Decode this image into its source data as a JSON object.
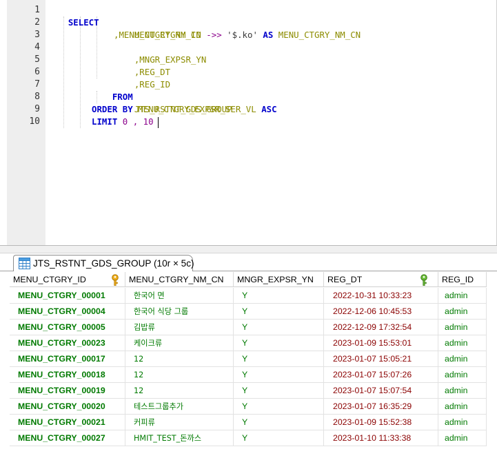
{
  "editor": {
    "line_numbers": [
      "1",
      "2",
      "3",
      "4",
      "5",
      "6",
      "7",
      "8",
      "9",
      "10"
    ],
    "sql": {
      "kw_select": "SELECT",
      "col_menu_ctgry_id": "MENU_CTGRY_ID",
      "line3_comma_col": ",MENU_CTGRY_NM_CN",
      "line3_op": "->>",
      "line3_str": "'$.ko'",
      "kw_as": "AS",
      "line3_alias": "MENU_CTGRY_NM_CN",
      "line4": ",MNGR_EXPSR_YN",
      "line5": ",REG_DT",
      "line6": ",REG_ID",
      "kw_from": "FROM",
      "table_name": "JTS_RSTNT_GDS_GROUP",
      "kw_order_by": "ORDER BY",
      "order_col": "MENU_CTGRY_EXPSR_SER_VL",
      "kw_asc": "ASC",
      "kw_limit": "LIMIT",
      "limit_offset": "0",
      "limit_comma": ",",
      "limit_count": "10"
    }
  },
  "result_tab": {
    "label": "JTS_RSTNT_GDS_GROUP (10r × 5c)",
    "icon": "table-grid-icon"
  },
  "grid": {
    "columns": [
      {
        "label": "MENU_CTGRY_ID",
        "icon": "primary-key-icon"
      },
      {
        "label": "MENU_CTGRY_NM_CN"
      },
      {
        "label": "MNGR_EXPSR_YN"
      },
      {
        "label": "REG_DT",
        "icon": "index-key-icon"
      },
      {
        "label": "REG_ID"
      }
    ],
    "rows": [
      {
        "id": "MENU_CTGRY_00001",
        "nm": "한국어 면",
        "yn": "Y",
        "dt": "2022-10-31 10:33:23",
        "reg": "admin"
      },
      {
        "id": "MENU_CTGRY_00004",
        "nm": "한국어 식당 그룹",
        "yn": "Y",
        "dt": "2022-12-06 10:45:53",
        "reg": "admin"
      },
      {
        "id": "MENU_CTGRY_00005",
        "nm": "김밥류",
        "yn": "Y",
        "dt": "2022-12-09 17:32:54",
        "reg": "admin"
      },
      {
        "id": "MENU_CTGRY_00023",
        "nm": "케이크류",
        "yn": "Y",
        "dt": "2023-01-09 15:53:01",
        "reg": "admin"
      },
      {
        "id": "MENU_CTGRY_00017",
        "nm": "12",
        "yn": "Y",
        "dt": "2023-01-07 15:05:21",
        "reg": "admin"
      },
      {
        "id": "MENU_CTGRY_00018",
        "nm": "12",
        "yn": "Y",
        "dt": "2023-01-07 15:07:26",
        "reg": "admin"
      },
      {
        "id": "MENU_CTGRY_00019",
        "nm": "12",
        "yn": "Y",
        "dt": "2023-01-07 15:07:54",
        "reg": "admin"
      },
      {
        "id": "MENU_CTGRY_00020",
        "nm": "테스트그룹추가",
        "yn": "Y",
        "dt": "2023-01-07 16:35:29",
        "reg": "admin"
      },
      {
        "id": "MENU_CTGRY_00021",
        "nm": "커피류",
        "yn": "Y",
        "dt": "2023-01-09 15:52:38",
        "reg": "admin"
      },
      {
        "id": "MENU_CTGRY_00027",
        "nm": "HMIT_TEST_돈까스",
        "yn": "Y",
        "dt": "2023-01-10 11:33:38",
        "reg": "admin"
      }
    ]
  },
  "colors": {
    "keyword": "#0000cc",
    "identifier": "#8c8c00",
    "operator": "#8b008b",
    "cell_text": "#007a00",
    "date_text": "#8b0000",
    "primary_key_icon": "#e8a317",
    "index_key_icon": "#5aa02c"
  }
}
